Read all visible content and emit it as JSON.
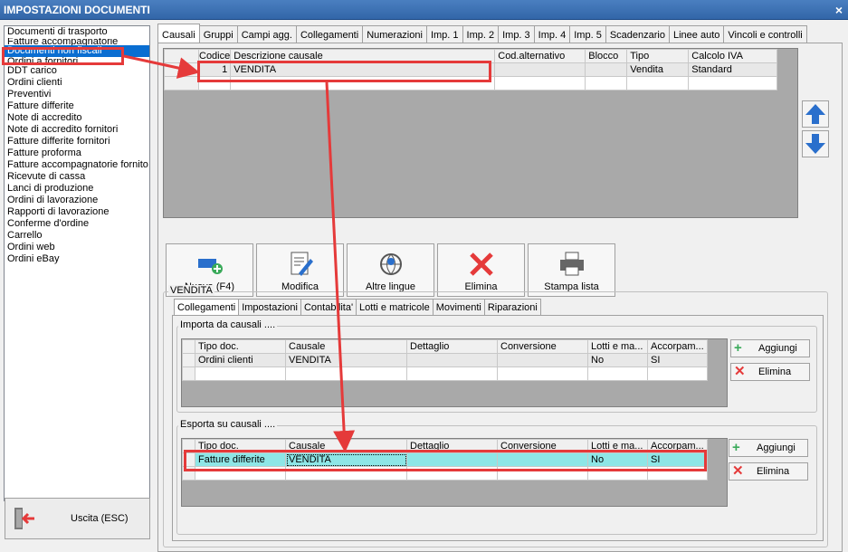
{
  "window": {
    "title": "IMPOSTAZIONI DOCUMENTI",
    "close": "×"
  },
  "doc_list": [
    "Documenti di trasporto",
    "Fatture accompagnatorie",
    "Documenti non fiscali",
    "Ordini a fornitori",
    "DDT carico",
    "Ordini clienti",
    "Preventivi",
    "Fatture differite",
    "Note di accredito",
    "Note di accredito fornitori",
    "Fatture differite fornitori",
    "Fatture proforma",
    "Fatture accompagnatorie fornito",
    "Ricevute di cassa",
    "Lanci di produzione",
    "Ordini di lavorazione",
    "Rapporti di lavorazione",
    "Conferme d'ordine",
    "Carrello",
    "Ordini web",
    "Ordini eBay"
  ],
  "exit_label": "Uscita (ESC)",
  "tabs": [
    "Causali",
    "Gruppi",
    "Campi agg.",
    "Collegamenti",
    "Numerazioni",
    "Imp. 1",
    "Imp. 2",
    "Imp. 3",
    "Imp. 4",
    "Imp. 5",
    "Scadenzario",
    "Linee auto",
    "Vincoli e controlli"
  ],
  "causali_grid": {
    "headers": [
      "Codice",
      "Descrizione causale",
      "Cod.alternativo",
      "Blocco",
      "Tipo",
      "Calcolo IVA"
    ],
    "row": [
      "1",
      "VENDITA",
      "",
      "",
      "Vendita",
      "Standard"
    ]
  },
  "toolbar": {
    "nuova": "Nuova (F4)",
    "modifica": "Modifica",
    "lingue": "Altre lingue",
    "elimina": "Elimina",
    "stampa": "Stampa lista"
  },
  "section_title": "VENDITA",
  "subtabs": [
    "Collegamenti",
    "Impostazioni",
    "Contabilita'",
    "Lotti e matricole",
    "Movimenti",
    "Riparazioni"
  ],
  "importa": {
    "title": "Importa da causali ....",
    "headers": [
      "Tipo doc.",
      "Causale",
      "Dettaglio",
      "Conversione",
      "Lotti e ma...",
      "Accorpam..."
    ],
    "row": [
      "Ordini clienti",
      "VENDITA",
      "",
      "",
      "No",
      "SI"
    ]
  },
  "esporta": {
    "title": "Esporta su causali ....",
    "headers": [
      "Tipo doc.",
      "Causale",
      "Dettaglio",
      "Conversione",
      "Lotti e ma...",
      "Accorpam..."
    ],
    "row": [
      "Fatture differite",
      "VENDITA",
      "",
      "",
      "No",
      "SI"
    ]
  },
  "buttons": {
    "aggiungi": "Aggiungi",
    "elimina": "Elimina"
  },
  "colors": {
    "accent_red": "#e53a3a",
    "selection": "#0a6ed1",
    "highlight_row": "#8ee6e6"
  }
}
